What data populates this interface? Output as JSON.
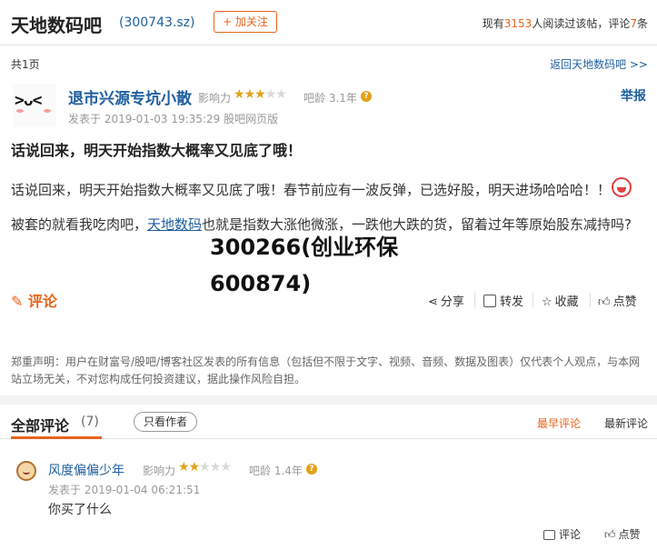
{
  "header": {
    "title": "天地数码吧",
    "stock_code": "(300743.sz)",
    "follow_label": "+ 加关注",
    "stats_prefix": "现有",
    "readers": "3153",
    "stats_mid": "人阅读过该帖，评论",
    "comments": "7",
    "stats_suffix": "条"
  },
  "nav": {
    "page_count": "共1页",
    "back_link": "返回天地数码吧 >>"
  },
  "post": {
    "author": "退市兴源专坑小散",
    "influence_label": "影响力",
    "influence_stars": 2.5,
    "bar_age": "吧龄 3.1年",
    "report": "举报",
    "posted": "发表于 2019-01-03 19:35:29 股吧网页版",
    "title": "话说回来，明天开始指数大概率又见底了哦！",
    "body_part1": "话说回来，明天开始指数大概率又见底了哦！春节前应有一波反弹，已选好股，明天进场哈哈哈！！",
    "body_part2": "被套的就看我吃肉吧，",
    "body_link": "天地数码",
    "body_part3": "也就是指数大涨他微涨，一跌他大跌的货，留着过年等原始股东减持吗?",
    "overlay_text": "300266(创业环保600874)",
    "comment_label": "评论",
    "actions": {
      "share": "分享",
      "forward": "转发",
      "favorite": "收藏",
      "like": "点赞"
    },
    "disclaimer": "郑重声明：用户在财富号/股吧/博客社区发表的所有信息（包括但不限于文字、视频、音频、数据及图表）仅代表个人观点，与本网站立场无关，不对您构成任何投资建议，据此操作风险自担。"
  },
  "comments_section": {
    "title": "全部评论",
    "count": "(7)",
    "author_only": "只看作者",
    "sort_early": "最早评论",
    "sort_new": "最新评论"
  },
  "comments": [
    {
      "author": "风度偏偏少年",
      "influence_label": "影响力",
      "influence_stars": 2,
      "bar_age": "吧龄 1.4年",
      "posted": "发表于 2019-01-04 06:21:51",
      "text": "你买了什么",
      "reply": "评论",
      "like": "点赞"
    }
  ],
  "colors": {
    "accent": "#e8641b",
    "link": "#1f5e9e",
    "star": "#e3a11a"
  }
}
